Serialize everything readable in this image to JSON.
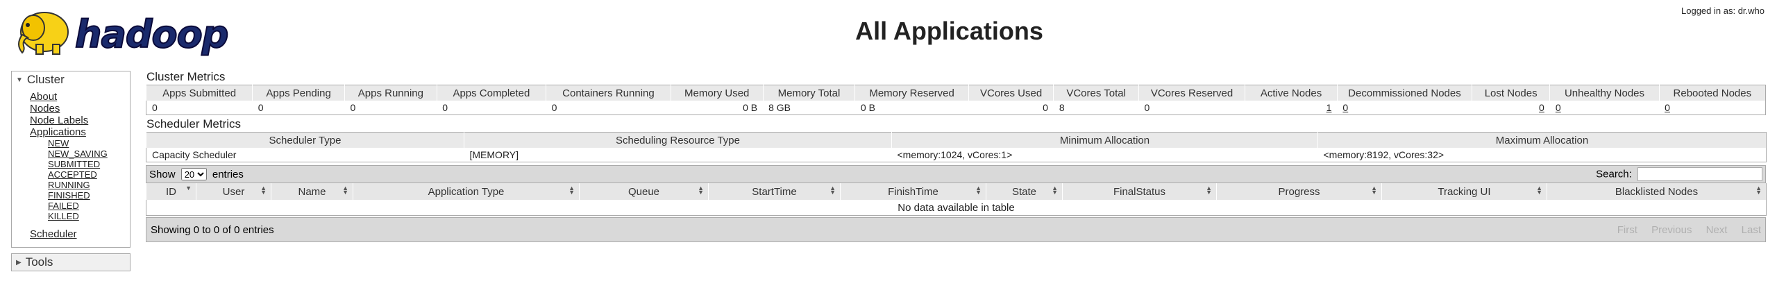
{
  "header": {
    "title": "All Applications",
    "logged_in": "Logged in as: dr.who",
    "logo_text": "hadoop"
  },
  "nav": {
    "cluster_label": "Cluster",
    "links": [
      "About",
      "Nodes",
      "Node Labels",
      "Applications"
    ],
    "app_states": [
      "NEW",
      "NEW_SAVING",
      "SUBMITTED",
      "ACCEPTED",
      "RUNNING",
      "FINISHED",
      "FAILED",
      "KILLED"
    ],
    "scheduler": "Scheduler",
    "tools_label": "Tools"
  },
  "cluster_metrics": {
    "title": "Cluster Metrics",
    "headers": [
      "Apps Submitted",
      "Apps Pending",
      "Apps Running",
      "Apps Completed",
      "Containers Running",
      "Memory Used",
      "Memory Total",
      "Memory Reserved",
      "VCores Used",
      "VCores Total",
      "VCores Reserved",
      "Active Nodes",
      "Decommissioned Nodes",
      "Lost Nodes",
      "Unhealthy Nodes",
      "Rebooted Nodes"
    ],
    "values": [
      "0",
      "0",
      "0",
      "0",
      "0",
      "0 B",
      "8 GB",
      "0 B",
      "0",
      "8",
      "0",
      "1",
      "0",
      "0",
      "0",
      "0"
    ]
  },
  "scheduler_metrics": {
    "title": "Scheduler Metrics",
    "headers": [
      "Scheduler Type",
      "Scheduling Resource Type",
      "Minimum Allocation",
      "Maximum Allocation"
    ],
    "values": [
      "Capacity Scheduler",
      "[MEMORY]",
      "<memory:1024, vCores:1>",
      "<memory:8192, vCores:32>"
    ]
  },
  "apps_table": {
    "show_label": "Show",
    "entries_label": "entries",
    "page_size": "20",
    "search_label": "Search:",
    "search_value": "",
    "columns": [
      "ID",
      "User",
      "Name",
      "Application Type",
      "Queue",
      "StartTime",
      "FinishTime",
      "State",
      "FinalStatus",
      "Progress",
      "Tracking UI",
      "Blacklisted Nodes"
    ],
    "empty_message": "No data available in table",
    "info": "Showing 0 to 0 of 0 entries",
    "paging": [
      "First",
      "Previous",
      "Next",
      "Last"
    ]
  }
}
